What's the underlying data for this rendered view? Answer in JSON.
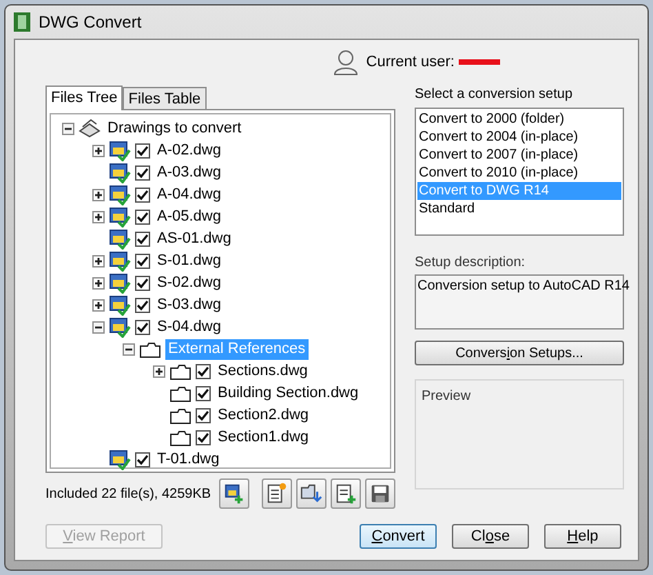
{
  "window": {
    "title": "DWG Convert"
  },
  "user": {
    "label": "Current user:",
    "redacted": true
  },
  "tabs": [
    {
      "label": "Files Tree",
      "selected": true
    },
    {
      "label": "Files Table",
      "selected": false
    }
  ],
  "tree": [
    {
      "kind": "root",
      "label": "Drawings to convert",
      "expandable": true,
      "expanded": true,
      "selected": false,
      "children": [
        {
          "kind": "drawing",
          "label": "A-02.dwg",
          "expandable": true,
          "expanded": false,
          "checked": true,
          "selected": false
        },
        {
          "kind": "drawing",
          "label": "A-03.dwg",
          "checked": true,
          "selected": false
        },
        {
          "kind": "drawing",
          "label": "A-04.dwg",
          "expandable": true,
          "expanded": false,
          "checked": true,
          "selected": false
        },
        {
          "kind": "drawing",
          "label": "A-05.dwg",
          "expandable": true,
          "expanded": false,
          "checked": true,
          "selected": false
        },
        {
          "kind": "drawing",
          "label": "AS-01.dwg",
          "checked": true,
          "selected": false
        },
        {
          "kind": "drawing",
          "label": "S-01.dwg",
          "expandable": true,
          "expanded": false,
          "checked": true,
          "selected": false
        },
        {
          "kind": "drawing",
          "label": "S-02.dwg",
          "expandable": true,
          "expanded": false,
          "checked": true,
          "selected": false
        },
        {
          "kind": "drawing",
          "label": "S-03.dwg",
          "expandable": true,
          "expanded": false,
          "checked": true,
          "selected": false
        },
        {
          "kind": "drawing",
          "label": "S-04.dwg",
          "expandable": true,
          "expanded": true,
          "checked": true,
          "selected": false,
          "children": [
            {
              "kind": "folder",
              "label": "External References",
              "expandable": true,
              "expanded": true,
              "selected": true,
              "children": [
                {
                  "kind": "xref",
                  "label": "Sections.dwg",
                  "expandable": true,
                  "expanded": false,
                  "checked": true,
                  "selected": false
                },
                {
                  "kind": "xref",
                  "label": "Building Section.dwg",
                  "checked": true,
                  "selected": false
                },
                {
                  "kind": "xref",
                  "label": "Section2.dwg",
                  "checked": true,
                  "selected": false
                },
                {
                  "kind": "xref",
                  "label": "Section1.dwg",
                  "checked": true,
                  "selected": false
                }
              ]
            }
          ]
        },
        {
          "kind": "drawing",
          "label": "T-01.dwg",
          "checked": true,
          "selected": false
        }
      ]
    }
  ],
  "summary": "Included 22 file(s), 4259KB",
  "toolbar": [
    {
      "kind": "add-drawing"
    },
    {
      "kind": "add-sheet-list"
    },
    {
      "kind": "add-folder"
    },
    {
      "kind": "append"
    },
    {
      "kind": "save"
    }
  ],
  "setups": {
    "label": "Select a conversion setup",
    "items": [
      {
        "label": "Convert to 2000 (folder)",
        "selected": false
      },
      {
        "label": "Convert to 2004 (in-place)",
        "selected": false
      },
      {
        "label": "Convert to 2007 (in-place)",
        "selected": false
      },
      {
        "label": "Convert to 2010 (in-place)",
        "selected": false
      },
      {
        "label": "Convert to DWG R14",
        "selected": true
      },
      {
        "label": "Standard",
        "selected": false
      }
    ]
  },
  "description": {
    "label": "Setup description:",
    "text": "Conversion setup to AutoCAD R14"
  },
  "setups_button": {
    "label": "Conversion Setups..."
  },
  "preview": {
    "label": "Preview"
  },
  "buttons": [
    {
      "label": "View Report",
      "disabled": true,
      "default": false
    },
    {
      "label": "Convert",
      "disabled": false,
      "default": true
    },
    {
      "label": "Close",
      "disabled": false,
      "default": false
    },
    {
      "label": "Help",
      "disabled": false,
      "default": false
    }
  ]
}
